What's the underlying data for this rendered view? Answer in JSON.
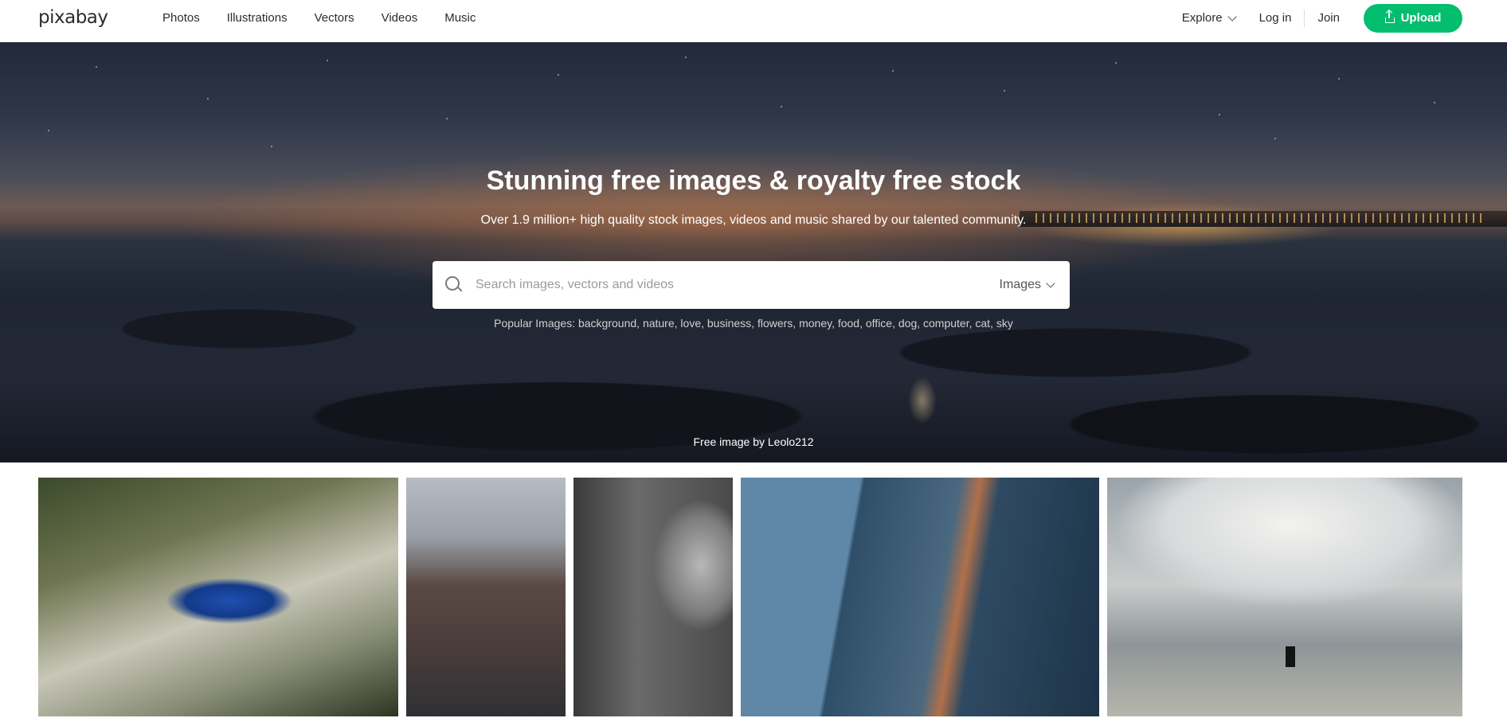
{
  "header": {
    "logo": "pixabay",
    "nav": [
      "Photos",
      "Illustrations",
      "Vectors",
      "Videos",
      "Music"
    ],
    "explore_label": "Explore",
    "login_label": "Log in",
    "join_label": "Join",
    "upload_label": "Upload"
  },
  "hero": {
    "title": "Stunning free images & royalty free stock",
    "subtitle": "Over 1.9 million+ high quality stock images, videos and music shared by our talented community.",
    "search": {
      "placeholder": "Search images, vectors and videos",
      "value": "",
      "type_selected": "Images"
    },
    "popular_label": "Popular Images:",
    "popular_tags": [
      "background",
      "nature",
      "love",
      "business",
      "flowers",
      "money",
      "food",
      "office",
      "dog",
      "computer",
      "cat",
      "sky"
    ],
    "credit_prefix": "Free image by",
    "credit_author": "Leolo212"
  },
  "icons": {
    "search": "search-icon",
    "upload": "upload-icon",
    "chevron": "chevron-down-icon"
  },
  "colors": {
    "accent": "#02be6e",
    "header_bg": "#ffffff",
    "text": "#2c2c2c"
  },
  "grid": {
    "images": [
      "bird-photo",
      "street-photo",
      "portrait-photo",
      "building-photo",
      "sea-photo"
    ]
  }
}
